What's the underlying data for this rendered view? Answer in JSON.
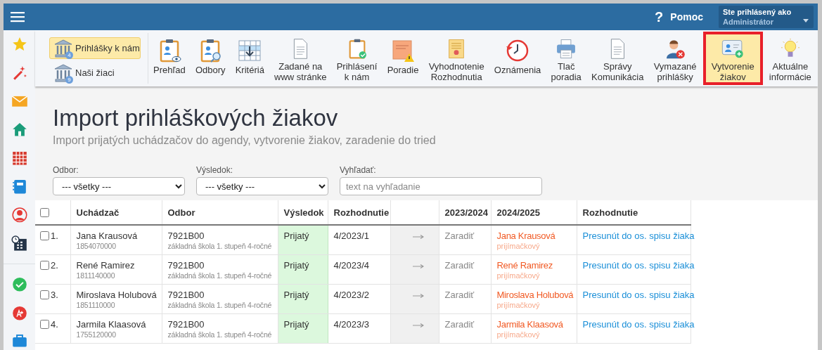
{
  "topbar": {
    "help": {
      "icon": "?",
      "label": "Pomoc"
    },
    "user": {
      "caption": "Ste prihlásený ako",
      "name": "Administrátor"
    }
  },
  "toolbar": {
    "left_buttons": [
      {
        "label": "Prihlášky k nám",
        "badge": "4",
        "selected": true
      },
      {
        "label": "Naši žiaci",
        "badge": "9",
        "selected": false
      }
    ],
    "items": [
      {
        "lines": [
          "Prehľad"
        ],
        "selected": false
      },
      {
        "lines": [
          "Odbory"
        ],
        "selected": false
      },
      {
        "lines": [
          "Kritériá"
        ],
        "selected": false
      },
      {
        "lines": [
          "Zadané na",
          "www stránke"
        ],
        "selected": false
      },
      {
        "lines": [
          "Prihlásení",
          "k nám"
        ],
        "selected": false
      },
      {
        "lines": [
          "Poradie"
        ],
        "selected": false
      },
      {
        "lines": [
          "Vyhodnotenie",
          "Rozhodnutia"
        ],
        "selected": false
      },
      {
        "lines": [
          "Oznámenia"
        ],
        "selected": false
      },
      {
        "lines": [
          "Tlač",
          "poradia"
        ],
        "selected": false
      },
      {
        "lines": [
          "Správy",
          "Komunikácia"
        ],
        "selected": false
      },
      {
        "lines": [
          "Vymazané",
          "prihlášky"
        ],
        "selected": false
      },
      {
        "lines": [
          "Vytvorenie",
          "žiakov"
        ],
        "selected": true
      },
      {
        "lines": [
          "Aktuálne",
          "informácie"
        ],
        "selected": false
      }
    ]
  },
  "page": {
    "title": "Import prihláškových žiakov",
    "subtitle": "Import prijatých uchádzačov do agendy, vytvorenie žiakov, zaradenie do tried"
  },
  "filters": [
    {
      "kind": "select",
      "label": "Odbor:",
      "value": "--- všetky ---"
    },
    {
      "kind": "select",
      "label": "Výsledok:",
      "value": "--- všetky ---"
    },
    {
      "kind": "search",
      "label": "Vyhľadať:",
      "placeholder": "text na vyhľadanie"
    }
  ],
  "table": {
    "select_all": {
      "checked": false
    },
    "columns": [
      {
        "kind": "text",
        "label": "Uchádzač"
      },
      {
        "kind": "text",
        "label": "Odbor"
      },
      {
        "kind": "text",
        "label": "Výsledok"
      },
      {
        "kind": "text",
        "label": "Rozhodnutie"
      },
      {
        "kind": "blank"
      },
      {
        "kind": "text",
        "label": "2023/2024"
      },
      {
        "kind": "text",
        "label": "2024/2025"
      },
      {
        "kind": "text",
        "label": "Rozhodnutie"
      }
    ],
    "rows": [
      {
        "checked": false,
        "number": "1.",
        "name": "Jana Krausová",
        "id": "1854070000",
        "code": "7921B00",
        "program": "základná škola 1. stupeň 4-ročné",
        "result": "Prijatý",
        "decision": "4/2023/1",
        "current": "Zaradiť",
        "next_name": "Jana Krausová",
        "next_kind": "prijímačkový",
        "action": "Presunút do os. spisu žiaka"
      },
      {
        "checked": false,
        "number": "2.",
        "name": "René Ramirez",
        "id": "1811140000",
        "code": "7921B00",
        "program": "základná škola 1. stupeň 4-ročné",
        "result": "Prijatý",
        "decision": "4/2023/4",
        "current": "Zaradiť",
        "next_name": "René Ramirez",
        "next_kind": "prijímačkový",
        "action": "Presunút do os. spisu žiaka"
      },
      {
        "checked": false,
        "number": "3.",
        "name": "Miroslava Holubová",
        "id": "1851110000",
        "code": "7921B00",
        "program": "základná škola 1. stupeň 4-ročné",
        "result": "Prijatý",
        "decision": "4/2023/2",
        "current": "Zaradiť",
        "next_name": "Miroslava Holubová",
        "next_kind": "prijímačkový",
        "action": "Presunút do os. spisu žiaka"
      },
      {
        "checked": false,
        "number": "4.",
        "name": "Jarmila Klaasová",
        "id": "1755120000",
        "code": "7921B00",
        "program": "základná škola 1. stupeň 4-ročné",
        "result": "Prijatý",
        "decision": "4/2023/3",
        "current": "Zaradiť",
        "next_name": "Jarmila Klaasová",
        "next_kind": "prijímačkový",
        "action": "Presunút do os. spisu žiaka"
      }
    ]
  }
}
